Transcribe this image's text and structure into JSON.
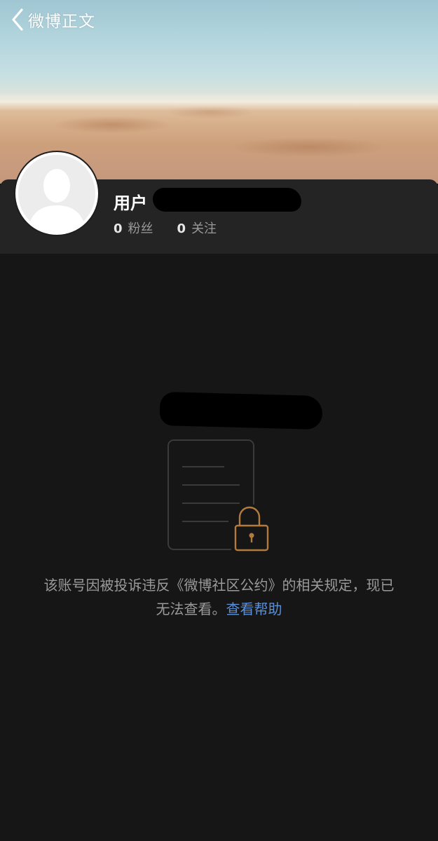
{
  "nav": {
    "back_label": "微博正文"
  },
  "profile": {
    "name_prefix": "用户",
    "followers_count": "0",
    "followers_label": "粉丝",
    "following_count": "0",
    "following_label": "关注"
  },
  "notice": {
    "text": "该账号因被投诉违反《微博社区公约》的相关规定，现已无法查看。",
    "help_link": "查看帮助"
  },
  "colors": {
    "background": "#161616",
    "card": "#242424",
    "link": "#5b8fd6",
    "lock_accent": "#b37a3e"
  },
  "icons": {
    "back": "chevron-left-icon",
    "avatar": "default-avatar-icon",
    "document": "document-icon",
    "lock": "lock-icon"
  }
}
